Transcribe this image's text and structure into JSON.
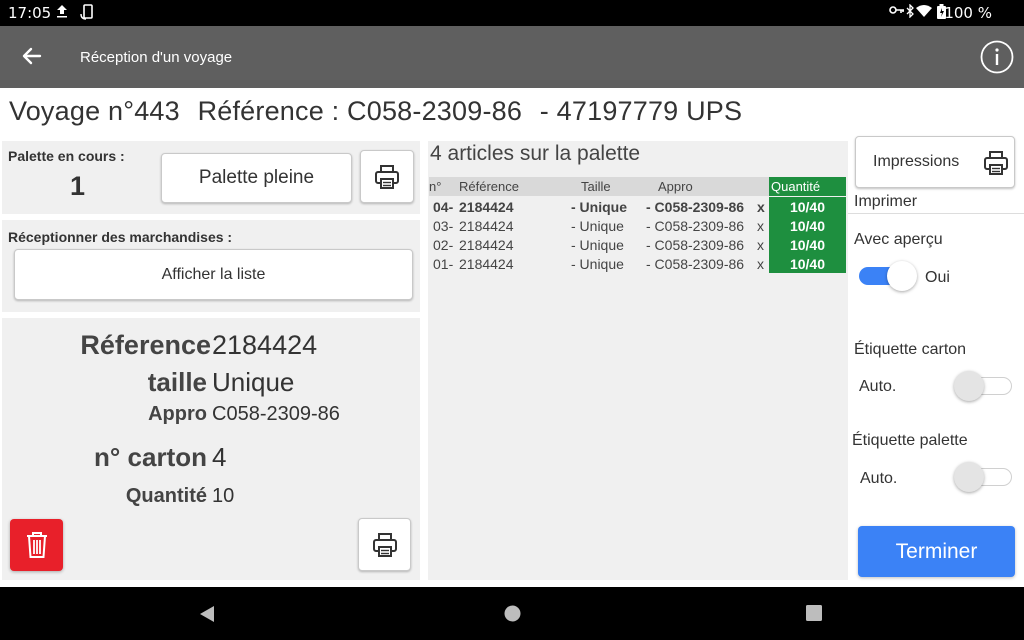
{
  "status_bar": {
    "time": "17:05",
    "battery": "100 %",
    "icons": [
      "upload-icon",
      "rotate-phone-icon",
      "key-icon",
      "bluetooth-icon",
      "wifi-icon",
      "battery-icon"
    ]
  },
  "app_bar": {
    "title": "Réception d'un voyage",
    "icons": [
      "back-arrow-icon",
      "info-icon"
    ]
  },
  "header": {
    "voyage": "Voyage n°443",
    "reference": "Référence : C058-2309-86",
    "carrier": "- 47197779 UPS"
  },
  "palette": {
    "label": "Palette en cours :",
    "number": "1",
    "full_button": "Palette pleine"
  },
  "receive": {
    "label": "Réceptionner des marchandises :",
    "list_button": "Afficher la liste"
  },
  "detail": {
    "reference_label": "Réference",
    "reference_value": "2184424",
    "size_label": "taille",
    "size_value": "Unique",
    "appro_label": "Appro",
    "appro_value": "C058-2309-86",
    "carton_label": "n° carton",
    "carton_value": "4",
    "quantity_label": "Quantité",
    "quantity_value": "10"
  },
  "articles": {
    "title": "4 articles sur la palette",
    "columns": {
      "num": "n°",
      "reference": "Référence",
      "size": "Taille",
      "appro": "Appro",
      "quantity": "Quantité"
    },
    "rows": [
      {
        "num": "04-",
        "reference": "2184424",
        "size": "- Unique",
        "appro": "- C058-2309-86",
        "x": "x",
        "quantity": "10/40",
        "bold": true
      },
      {
        "num": "03-",
        "reference": "2184424",
        "size": "- Unique",
        "appro": "- C058-2309-86",
        "x": "x",
        "quantity": "10/40",
        "bold": false
      },
      {
        "num": "02-",
        "reference": "2184424",
        "size": "- Unique",
        "appro": "- C058-2309-86",
        "x": "x",
        "quantity": "10/40",
        "bold": false
      },
      {
        "num": "01-",
        "reference": "2184424",
        "size": "- Unique",
        "appro": "- C058-2309-86",
        "x": "x",
        "quantity": "10/40",
        "bold": false
      }
    ]
  },
  "right_panel": {
    "impressions_button": "Impressions",
    "print_label": "Imprimer",
    "preview_label": "Avec aperçu",
    "preview_toggle": "Oui",
    "preview_on": true,
    "carton_label": "Étiquette carton",
    "carton_mode": "Auto.",
    "carton_on": false,
    "pallet_label": "Étiquette palette",
    "pallet_mode": "Auto.",
    "pallet_on": false,
    "finish_button": "Terminer"
  },
  "colors": {
    "app_bar": "#5f5f5f",
    "quantity_green": "#1e8f3f",
    "accent_blue": "#3b82f6",
    "delete_red": "#e8202a",
    "panel_gray": "#f0f0f0"
  }
}
